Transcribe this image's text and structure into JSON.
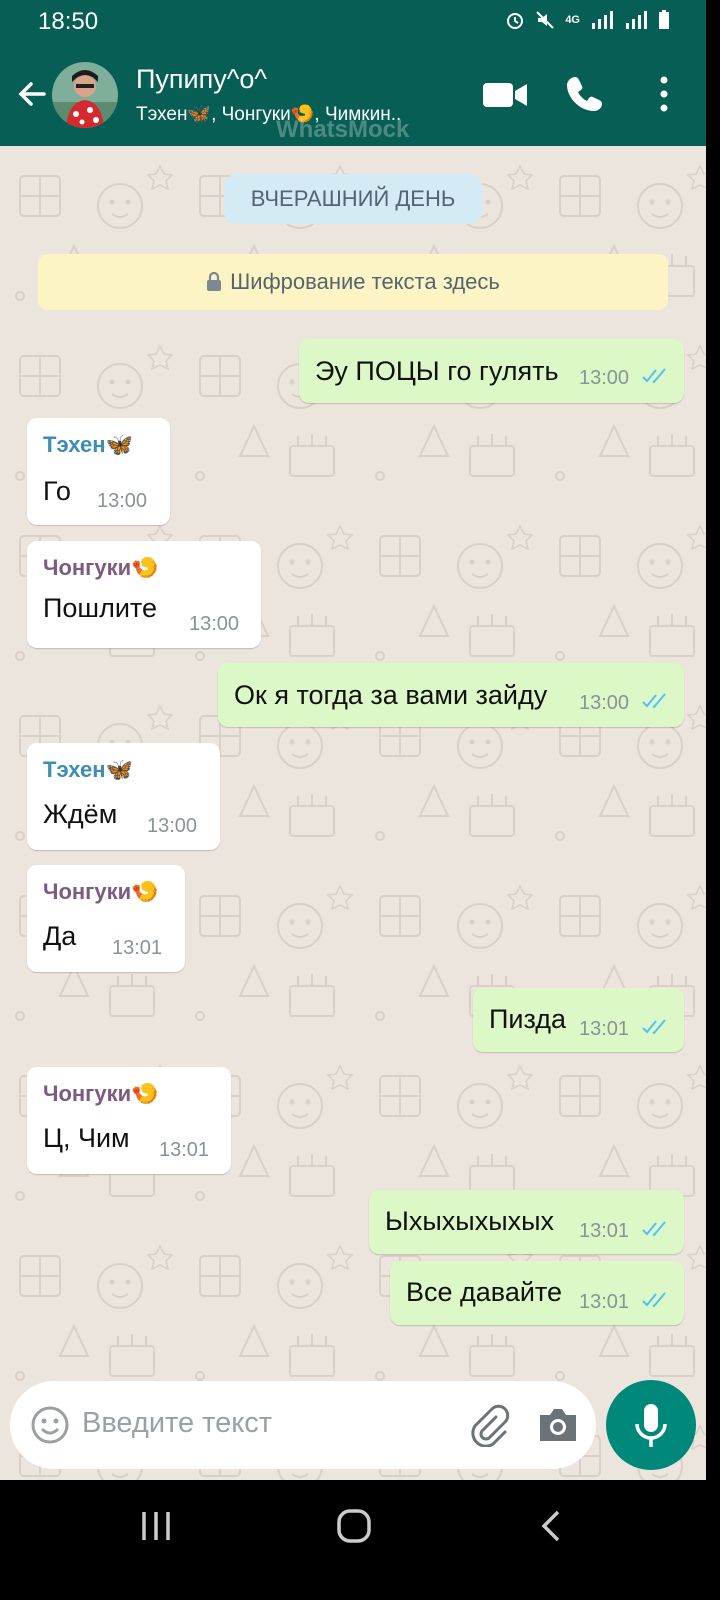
{
  "status": {
    "time": "18:50",
    "network": "4G"
  },
  "header": {
    "title": "Пупипу^о^",
    "subtitle": "Тэхен🦋, Чонгуки🍤, Чимкин..",
    "watermark": "WhatsMock"
  },
  "chat": {
    "date_chip": "ВЧЕРАШНИЙ ДЕНЬ",
    "encryption_text": "Шифрование текста здесь",
    "messages": [
      {
        "type": "out",
        "text": "Эу ПОЦЫ го гулять",
        "time": "13:00",
        "status": "read"
      },
      {
        "type": "in",
        "sender": "Тэхен🦋",
        "text": "Го",
        "time": "13:00"
      },
      {
        "type": "in",
        "sender": "Чонгуки🍤",
        "text": "Пошлите",
        "time": "13:00"
      },
      {
        "type": "out",
        "text": "Ок я тогда за вами зайду",
        "time": "13:00",
        "status": "read"
      },
      {
        "type": "in",
        "sender": "Тэхен🦋",
        "text": "Ждём",
        "time": "13:00"
      },
      {
        "type": "in",
        "sender": "Чонгуки🍤",
        "text": "Да",
        "time": "13:01"
      },
      {
        "type": "out",
        "text": "Пизда",
        "time": "13:01",
        "status": "read"
      },
      {
        "type": "in",
        "sender": "Чонгуки🍤",
        "text": "Ц, Чим",
        "time": "13:01"
      },
      {
        "type": "out",
        "text": "Ыхыхыхыхых",
        "time": "13:01",
        "status": "read"
      },
      {
        "type": "out",
        "text": "Все давайте",
        "time": "13:01",
        "status": "read"
      }
    ]
  },
  "input": {
    "placeholder": "Введите текст"
  },
  "colors": {
    "header": "#075e54",
    "chat_bg": "#ece5dd",
    "outgoing": "#dcf8c6",
    "incoming": "#ffffff",
    "mic_button": "#00897b",
    "read_ticks": "#4fc3f7"
  },
  "icons": [
    "back-arrow-icon",
    "video-call-icon",
    "phone-icon",
    "more-icon",
    "lock-icon",
    "emoji-icon",
    "attach-icon",
    "camera-icon",
    "mic-icon",
    "double-check-icon"
  ]
}
